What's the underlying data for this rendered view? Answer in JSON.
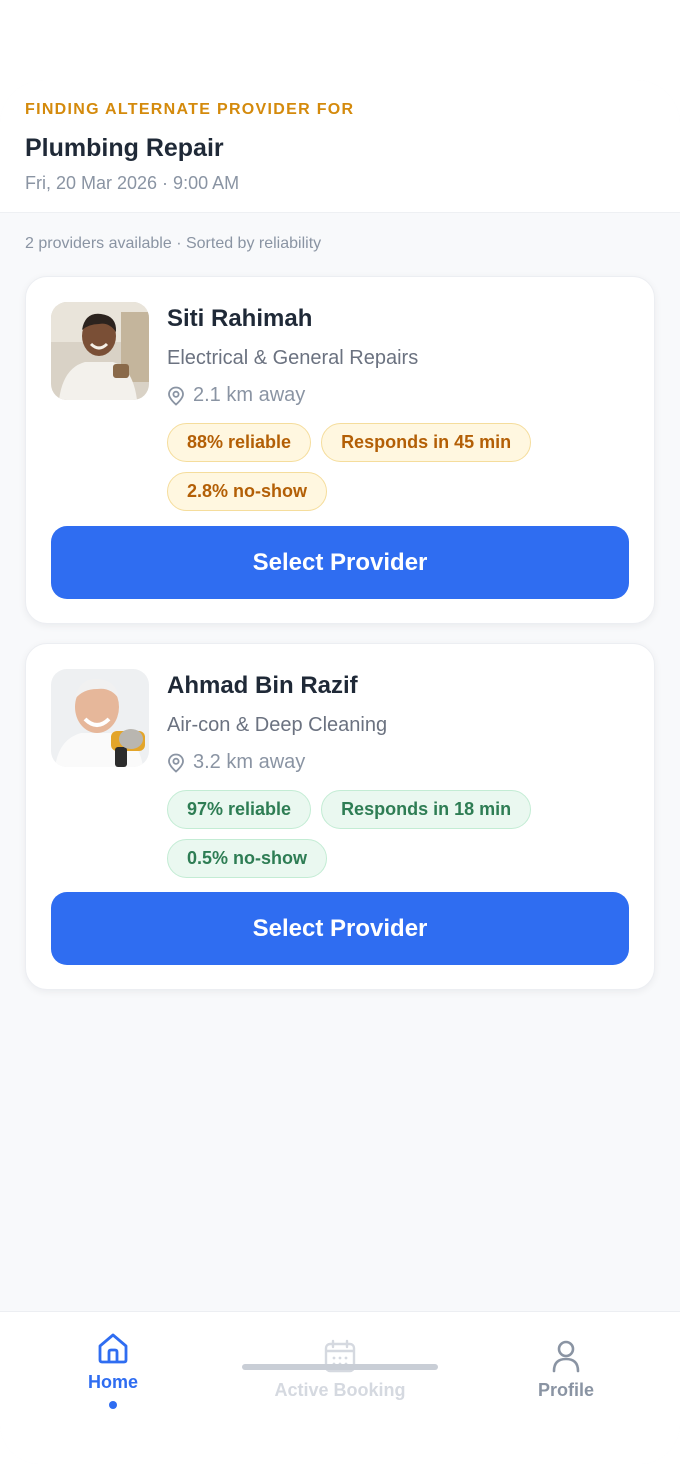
{
  "header": {
    "eyebrow": "FINDING ALTERNATE PROVIDER FOR",
    "service": "Plumbing Repair",
    "datetime": "Fri, 20 Mar 2026 · 9:00 AM"
  },
  "results_meta": "2 providers available · Sorted by reliability",
  "providers": [
    {
      "name": "Siti Rahimah",
      "specialty": "Electrical & General Repairs",
      "distance": "2.1 km away",
      "reliability": "88% reliable",
      "response": "Responds in 45 min",
      "no_show": "2.8% no-show",
      "badge_color": "#b35f06",
      "button_label": "Select Provider"
    },
    {
      "name": "Ahmad Bin Razif",
      "specialty": "Air-con & Deep Cleaning",
      "distance": "3.2 km away",
      "reliability": "97% reliable",
      "response": "Responds in 18 min",
      "no_show": "0.5% no-show",
      "badge_color": "#2e7d54",
      "button_label": "Select Provider"
    }
  ],
  "tabbar": {
    "items": [
      {
        "label": "Home",
        "icon": "home-icon",
        "active": true
      },
      {
        "label": "Active Booking",
        "icon": "calendar-icon",
        "disabled": true
      },
      {
        "label": "Profile",
        "icon": "user-icon"
      }
    ]
  },
  "colors": {
    "accent": "#2f6df1",
    "eyebrow": "#d48a0c"
  }
}
